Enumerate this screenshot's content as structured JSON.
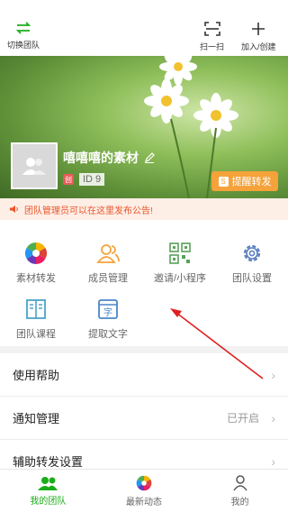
{
  "topbar": {
    "switch_label": "切换团队",
    "scan_label": "扫一扫",
    "join_label": "加入/创建"
  },
  "profile": {
    "team_name": "嘻嘻嘻的素材",
    "id_badge": "创",
    "id_label": "ID 9",
    "remind_button": "提醒转发",
    "remind_icon": "S"
  },
  "notice": {
    "text": "团队管理员可以在这里发布公告!"
  },
  "grid": {
    "items": [
      {
        "label": "素材转发"
      },
      {
        "label": "成员管理"
      },
      {
        "label": "邀请/小程序"
      },
      {
        "label": "团队设置"
      },
      {
        "label": "团队课程"
      },
      {
        "label": "提取文字",
        "icon_text": "字"
      }
    ]
  },
  "list": {
    "items": [
      {
        "label": "使用帮助",
        "value": ""
      },
      {
        "label": "通知管理",
        "value": "已开启"
      },
      {
        "label": "辅助转发设置",
        "value": ""
      }
    ]
  },
  "bottom_nav": {
    "items": [
      {
        "label": "我的团队"
      },
      {
        "label": "最新动态"
      },
      {
        "label": "我的"
      }
    ]
  },
  "colors": {
    "accent": "#1aad19",
    "orange": "#f5a23a",
    "notice_text": "#e8562a"
  }
}
